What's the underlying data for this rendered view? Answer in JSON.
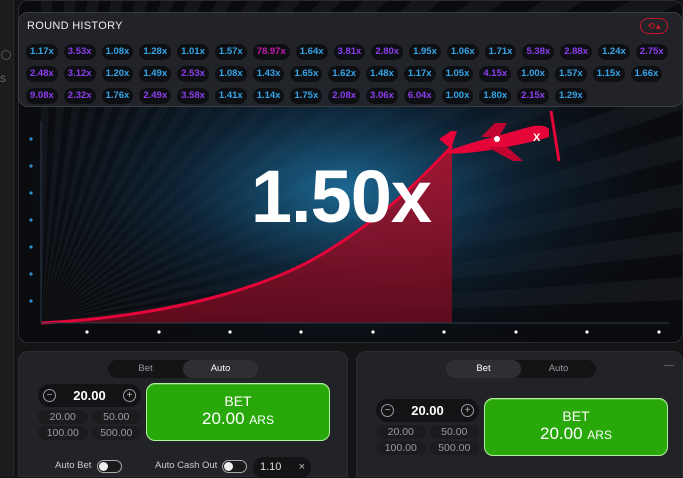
{
  "round_history": {
    "title": "ROUND HISTORY",
    "toggle_icons": [
      "⟲",
      "▴"
    ],
    "rows": [
      [
        {
          "v": "1.17x",
          "c": "blue"
        },
        {
          "v": "3.53x",
          "c": "purple"
        },
        {
          "v": "1.08x",
          "c": "blue"
        },
        {
          "v": "1.28x",
          "c": "blue"
        },
        {
          "v": "1.01x",
          "c": "blue"
        },
        {
          "v": "1.57x",
          "c": "blue"
        },
        {
          "v": "78.97x",
          "c": "pink"
        },
        {
          "v": "1.64x",
          "c": "blue"
        },
        {
          "v": "3.81x",
          "c": "purple"
        },
        {
          "v": "2.80x",
          "c": "purple"
        },
        {
          "v": "1.95x",
          "c": "blue"
        },
        {
          "v": "1.06x",
          "c": "blue"
        },
        {
          "v": "1.71x",
          "c": "blue"
        },
        {
          "v": "5.38x",
          "c": "purple"
        },
        {
          "v": "2.88x",
          "c": "purple"
        },
        {
          "v": "1.24x",
          "c": "blue"
        },
        {
          "v": "2.75x",
          "c": "purple"
        }
      ],
      [
        {
          "v": "2.48x",
          "c": "purple"
        },
        {
          "v": "3.12x",
          "c": "purple"
        },
        {
          "v": "1.20x",
          "c": "blue"
        },
        {
          "v": "1.49x",
          "c": "blue"
        },
        {
          "v": "2.53x",
          "c": "purple"
        },
        {
          "v": "1.08x",
          "c": "blue"
        },
        {
          "v": "1.43x",
          "c": "blue"
        },
        {
          "v": "1.65x",
          "c": "blue"
        },
        {
          "v": "1.62x",
          "c": "blue"
        },
        {
          "v": "1.48x",
          "c": "blue"
        },
        {
          "v": "1.17x",
          "c": "blue"
        },
        {
          "v": "1.05x",
          "c": "blue"
        },
        {
          "v": "4.15x",
          "c": "purple"
        },
        {
          "v": "1.00x",
          "c": "blue"
        },
        {
          "v": "1.57x",
          "c": "blue"
        },
        {
          "v": "1.15x",
          "c": "blue"
        },
        {
          "v": "1.66x",
          "c": "blue"
        }
      ],
      [
        {
          "v": "9.08x",
          "c": "purple"
        },
        {
          "v": "2.32x",
          "c": "purple"
        },
        {
          "v": "1.76x",
          "c": "blue"
        },
        {
          "v": "2.49x",
          "c": "purple"
        },
        {
          "v": "3.58x",
          "c": "purple"
        },
        {
          "v": "1.41x",
          "c": "blue"
        },
        {
          "v": "1.14x",
          "c": "blue"
        },
        {
          "v": "1.75x",
          "c": "blue"
        },
        {
          "v": "2.08x",
          "c": "purple"
        },
        {
          "v": "3.06x",
          "c": "purple"
        },
        {
          "v": "6.04x",
          "c": "purple"
        },
        {
          "v": "1.00x",
          "c": "blue"
        },
        {
          "v": "1.80x",
          "c": "blue"
        },
        {
          "v": "2.15x",
          "c": "purple"
        },
        {
          "v": "1.29x",
          "c": "blue"
        }
      ]
    ]
  },
  "game": {
    "multiplier": "1.50x",
    "plane_color": "#e50539",
    "plane_letter": "X"
  },
  "left_strip": {
    "letter": "S"
  },
  "colors": {
    "blue": "#35a5e8",
    "purple": "#8c3eef",
    "pink": "#c41bad",
    "bet_green": "#28a909",
    "accent_red": "#e50539"
  },
  "panels": [
    {
      "tabs": [
        "Bet",
        "Auto"
      ],
      "active_tab": "Auto",
      "amount": "20.00",
      "minus_icon": "−",
      "plus_icon": "+",
      "quick_amounts": [
        "20.00",
        "50.00",
        "100.00",
        "500.00"
      ],
      "bet_label": "BET",
      "bet_amount": "20.00",
      "currency": "ARS",
      "auto_bet_label": "Auto Bet",
      "auto_cashout_label": "Auto Cash Out",
      "auto_cashout_value": "1.10",
      "auto_cashout_clear": "×"
    },
    {
      "tabs": [
        "Bet",
        "Auto"
      ],
      "active_tab": "Bet",
      "remove_label": "—",
      "amount": "20.00",
      "minus_icon": "−",
      "plus_icon": "+",
      "quick_amounts": [
        "20.00",
        "50.00",
        "100.00",
        "500.00"
      ],
      "bet_label": "BET",
      "bet_amount": "20.00",
      "currency": "ARS"
    }
  ]
}
